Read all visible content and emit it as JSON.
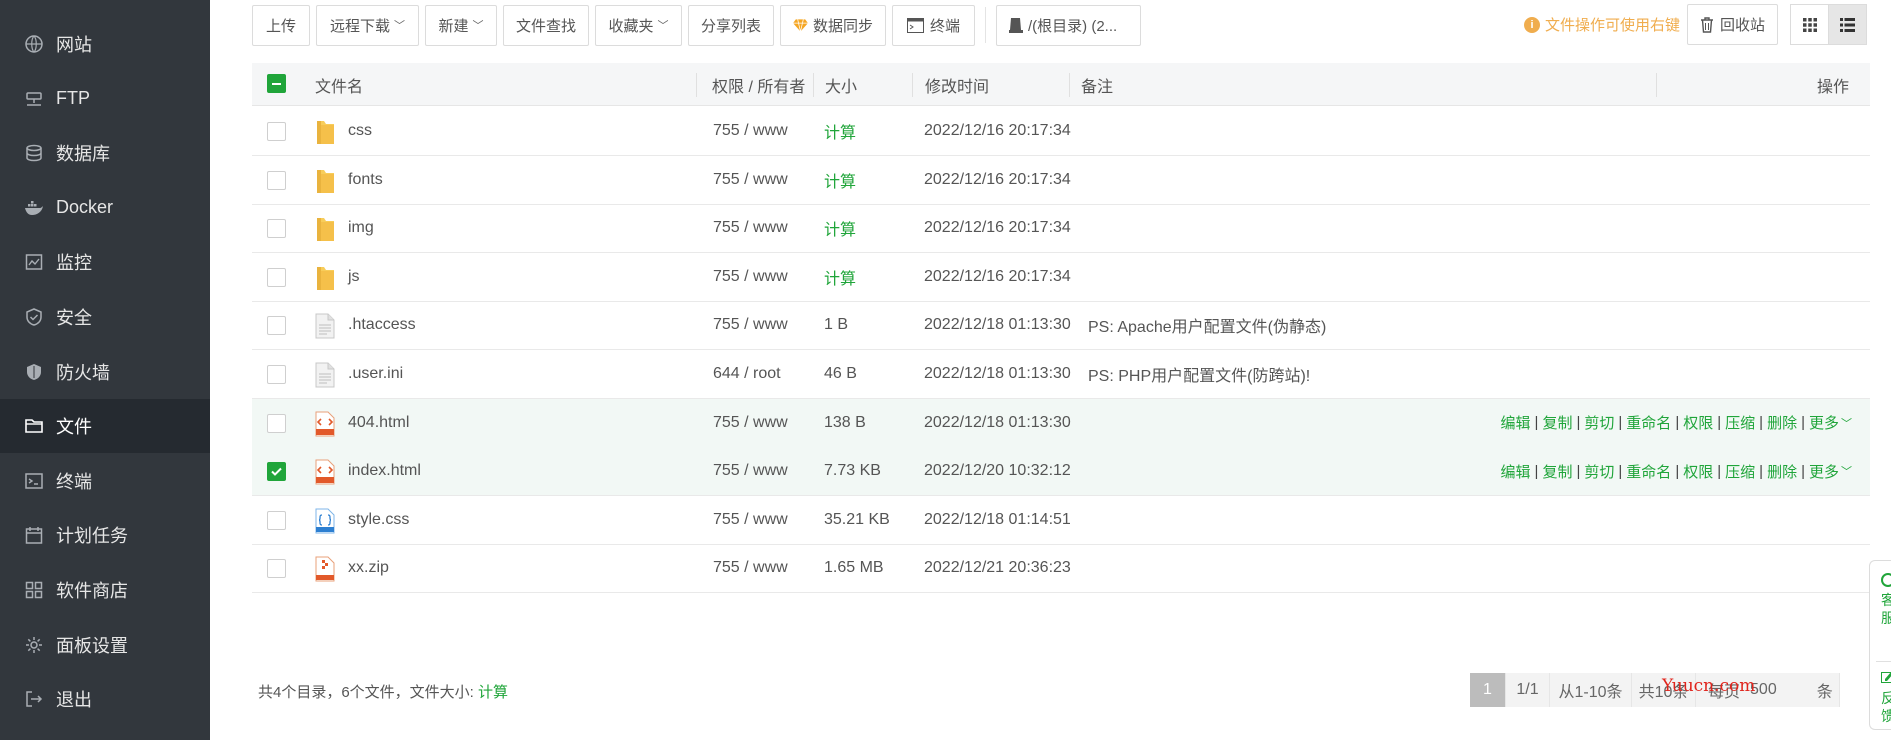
{
  "sidebar": {
    "items": [
      {
        "label": "网站",
        "icon": "globe-icon"
      },
      {
        "label": "FTP",
        "icon": "ftp-icon"
      },
      {
        "label": "数据库",
        "icon": "database-icon"
      },
      {
        "label": "Docker",
        "icon": "docker-icon"
      },
      {
        "label": "监控",
        "icon": "monitor-icon"
      },
      {
        "label": "安全",
        "icon": "shield-check-icon"
      },
      {
        "label": "防火墙",
        "icon": "firewall-icon"
      },
      {
        "label": "文件",
        "icon": "folder-icon",
        "active": true
      },
      {
        "label": "终端",
        "icon": "terminal-icon"
      },
      {
        "label": "计划任务",
        "icon": "calendar-icon"
      },
      {
        "label": "软件商店",
        "icon": "grid-icon"
      },
      {
        "label": "面板设置",
        "icon": "gear-icon"
      },
      {
        "label": "退出",
        "icon": "logout-icon"
      }
    ]
  },
  "toolbar": {
    "upload": "上传",
    "remote_download": "远程下载",
    "new": "新建",
    "file_search": "文件查找",
    "favorites": "收藏夹",
    "share_list": "分享列表",
    "data_sync": "数据同步",
    "terminal": "终端",
    "path": "/(根目录) (2..."
  },
  "hint": "文件操作可使用右键",
  "recycle_bin": "回收站",
  "table": {
    "headers": {
      "name": "文件名",
      "perm": "权限 / 所有者",
      "size": "大小",
      "mtime": "修改时间",
      "note": "备注",
      "ops": "操作"
    },
    "ops": [
      "编辑",
      "复制",
      "剪切",
      "重命名",
      "权限",
      "压缩",
      "删除",
      "更多"
    ],
    "rows": [
      {
        "name": "css",
        "perm": "755 / www",
        "size": "计算",
        "mtime": "2022/12/16 20:17:34",
        "note": "",
        "type": "folder",
        "checked": false,
        "hover": false
      },
      {
        "name": "fonts",
        "perm": "755 / www",
        "size": "计算",
        "mtime": "2022/12/16 20:17:34",
        "note": "",
        "type": "folder",
        "checked": false,
        "hover": false
      },
      {
        "name": "img",
        "perm": "755 / www",
        "size": "计算",
        "mtime": "2022/12/16 20:17:34",
        "note": "",
        "type": "folder",
        "checked": false,
        "hover": false
      },
      {
        "name": "js",
        "perm": "755 / www",
        "size": "计算",
        "mtime": "2022/12/16 20:17:34",
        "note": "",
        "type": "folder",
        "checked": false,
        "hover": false
      },
      {
        "name": ".htaccess",
        "perm": "755 / www",
        "size": "1 B",
        "mtime": "2022/12/18 01:13:30",
        "note": "PS: Apache用户配置文件(伪静态)",
        "type": "text",
        "checked": false,
        "hover": false
      },
      {
        "name": ".user.ini",
        "perm": "644 / root",
        "size": "46 B",
        "mtime": "2022/12/18 01:13:30",
        "note": "PS: PHP用户配置文件(防跨站)!",
        "type": "text",
        "checked": false,
        "hover": false
      },
      {
        "name": "404.html",
        "perm": "755 / www",
        "size": "138 B",
        "mtime": "2022/12/18 01:13:30",
        "note": "",
        "type": "html",
        "checked": false,
        "hover": true
      },
      {
        "name": "index.html",
        "perm": "755 / www",
        "size": "7.73 KB",
        "mtime": "2022/12/20 10:32:12",
        "note": "",
        "type": "html",
        "checked": true,
        "hover": true
      },
      {
        "name": "style.css",
        "perm": "755 / www",
        "size": "35.21 KB",
        "mtime": "2022/12/18 01:14:51",
        "note": "",
        "type": "css",
        "checked": false,
        "hover": false
      },
      {
        "name": "xx.zip",
        "perm": "755 / www",
        "size": "1.65 MB",
        "mtime": "2022/12/21 20:36:23",
        "note": "",
        "type": "zip",
        "checked": false,
        "hover": false
      }
    ]
  },
  "footer": {
    "summary": "共4个目录，6个文件，文件大小:",
    "calc": "计算"
  },
  "pagination": {
    "current": "1",
    "pages": "1/1",
    "range": "从1-10条",
    "total": "共10条",
    "per_page_label": "每页",
    "per_page": "500",
    "unit": "条"
  },
  "watermark": "Yuucn.com",
  "service_tab": {
    "kefu": "客服",
    "fankui": "反馈"
  },
  "colors": {
    "accent": "#20a53a",
    "sidebar_bg": "#32373d",
    "sidebar_active": "#252a30",
    "hint": "#f0ad4e",
    "row_highlight": "#f2f8f5"
  }
}
